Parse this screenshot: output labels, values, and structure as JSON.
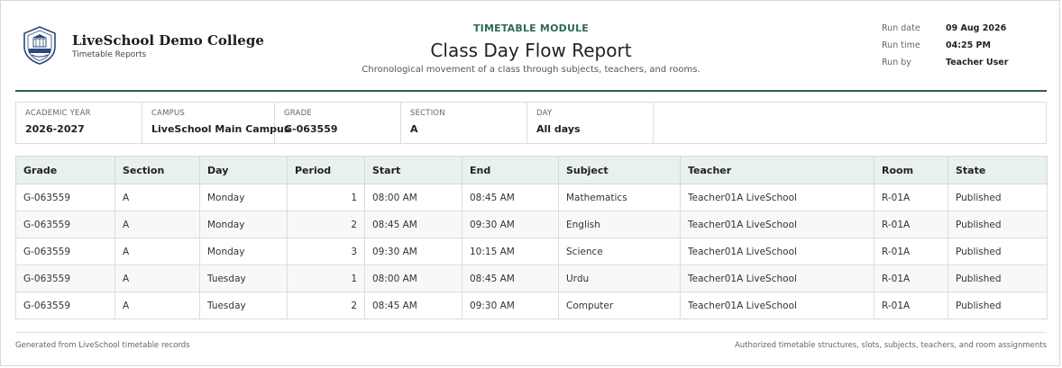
{
  "institution": {
    "name": "LiveSchool Demo College",
    "subtitle": "Timetable Reports"
  },
  "report": {
    "module": "TIMETABLE MODULE",
    "title": "Class Day Flow Report",
    "description": "Chronological movement of a class through subjects, teachers, and rooms."
  },
  "run_info": [
    {
      "label": "Run date",
      "value": "09 Aug 2026"
    },
    {
      "label": "Run time",
      "value": "04:25 PM"
    },
    {
      "label": "Run by",
      "value": "Teacher User"
    }
  ],
  "filters": [
    {
      "label": "Academic Year",
      "value": "2026-2027"
    },
    {
      "label": "Campus",
      "value": "LiveSchool Main Campus"
    },
    {
      "label": "Grade",
      "value": "G-063559"
    },
    {
      "label": "Section",
      "value": "A"
    },
    {
      "label": "Day",
      "value": "All days"
    }
  ],
  "table": {
    "columns": [
      "Grade",
      "Section",
      "Day",
      "Period",
      "Start",
      "End",
      "Subject",
      "Teacher",
      "Room",
      "State"
    ],
    "rows": [
      [
        "G-063559",
        "A",
        "Monday",
        "1",
        "08:00 AM",
        "08:45 AM",
        "Mathematics",
        "Teacher01A LiveSchool",
        "R-01A",
        "Published"
      ],
      [
        "G-063559",
        "A",
        "Monday",
        "2",
        "08:45 AM",
        "09:30 AM",
        "English",
        "Teacher01A LiveSchool",
        "R-01A",
        "Published"
      ],
      [
        "G-063559",
        "A",
        "Monday",
        "3",
        "09:30 AM",
        "10:15 AM",
        "Science",
        "Teacher01A LiveSchool",
        "R-01A",
        "Published"
      ],
      [
        "G-063559",
        "A",
        "Tuesday",
        "1",
        "08:00 AM",
        "08:45 AM",
        "Urdu",
        "Teacher01A LiveSchool",
        "R-01A",
        "Published"
      ],
      [
        "G-063559",
        "A",
        "Tuesday",
        "2",
        "08:45 AM",
        "09:30 AM",
        "Computer",
        "Teacher01A LiveSchool",
        "R-01A",
        "Published"
      ]
    ]
  },
  "footer": {
    "left": "Generated from LiveSchool timetable records",
    "right": "Authorized timetable structures, slots, subjects, teachers, and room assignments"
  },
  "colors": {
    "accent": "#2f5e4f",
    "module_text": "#2d6b55",
    "header_fill": "#e8f1ed"
  },
  "icons": {
    "logo": "school-crest-icon"
  }
}
